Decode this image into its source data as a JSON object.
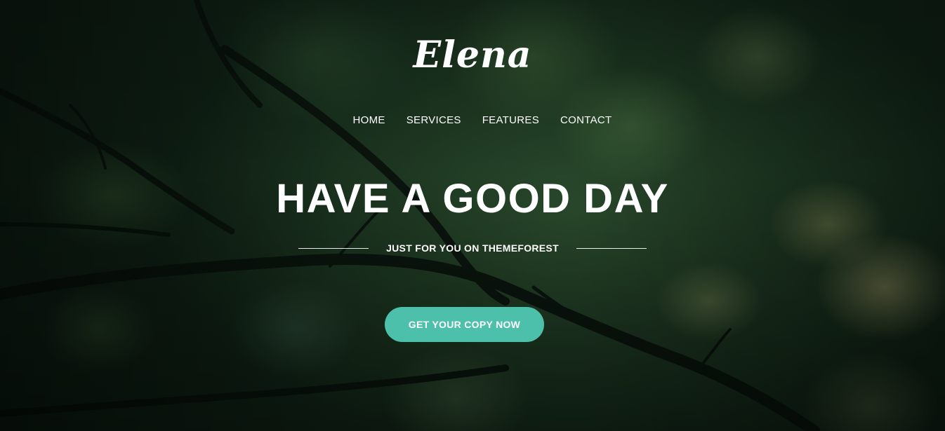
{
  "brand": {
    "logo_text": "Elena"
  },
  "nav": {
    "items": [
      {
        "label": "HOME"
      },
      {
        "label": "SERVICES"
      },
      {
        "label": "FEATURES"
      },
      {
        "label": "CONTACT"
      }
    ]
  },
  "hero": {
    "headline": "HAVE A GOOD DAY",
    "subheadline": "JUST FOR YOU ON THEMEFOREST",
    "cta_label": "GET YOUR COPY NOW"
  },
  "colors": {
    "accent": "#4cc0aa",
    "text": "#ffffff",
    "background": "#1a3321"
  }
}
